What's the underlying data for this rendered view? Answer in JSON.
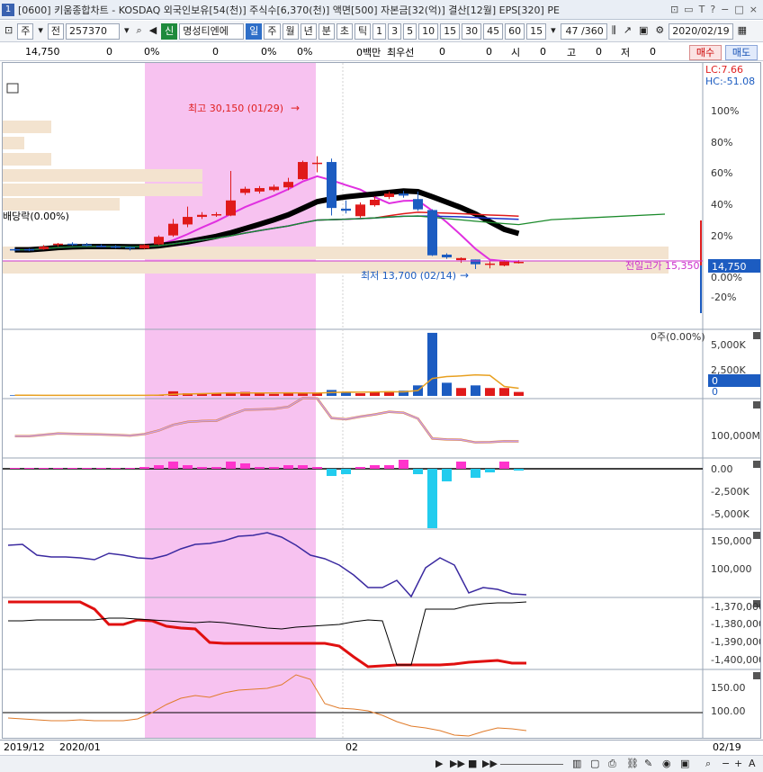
{
  "window": {
    "number": "1",
    "title": "[0600] 키움종합차트 - KOSDAQ 외국인보유[54(천)] 주식수[6,370(천)] 액면[500] 자본금[32(억)] 결산[12월] EPS[320] PE",
    "buttons": [
      "⊡",
      "▭",
      "T",
      "?",
      "−",
      "□",
      "×"
    ]
  },
  "toolbar": {
    "period_select": "주",
    "range_label": "전",
    "stock_code": "257370",
    "search_icon": "search-icon",
    "badge": "신",
    "stock_name": "명성티엔에",
    "periods": [
      "일",
      "주",
      "월",
      "년",
      "분",
      "초",
      "틱"
    ],
    "active_period": "일",
    "intervals": [
      "1",
      "3",
      "5",
      "10",
      "15",
      "30",
      "45",
      "60"
    ],
    "count_select": "15",
    "page": "47 /360",
    "date": "2020/02/19"
  },
  "quote": {
    "price": "14,750",
    "v1": "0",
    "v2": "0%",
    "v3": "0",
    "v4": "0%",
    "v5": "0%",
    "amount": "0백만",
    "best_ask_label": "최우선",
    "v6": "0",
    "v7": "0",
    "open_label": "시",
    "open": "0",
    "high_label": "고",
    "high": "0",
    "low_label": "저",
    "low": "0",
    "buy": "매수",
    "sell": "매도"
  },
  "price_panel": {
    "lc": "LC:7.66",
    "hc": "HC:-51.08",
    "y_labels": [
      "100%",
      "80%",
      "60%",
      "40%",
      "20%",
      "0.00%",
      "-20%"
    ],
    "high_note": "최고 30,150 (01/29)",
    "low_note": "최저 13,700 (02/14)",
    "prev_close_note": "전일고가 15,350",
    "dividend_note": "배당락(0.00%)",
    "current_price": "14,750"
  },
  "volume_panel": {
    "note": "0주(0.00%)",
    "y_labels": [
      "5,000K",
      "2,500K",
      "0"
    ],
    "current": "0"
  },
  "amount_panel": {
    "y_labels": [
      "100,000M"
    ]
  },
  "foreign_panel": {
    "y_labels": [
      "0.00",
      "-2,500K",
      "-5,000K"
    ]
  },
  "indicator1": {
    "y_labels": [
      "150,000",
      "100,000"
    ]
  },
  "indicator2": {
    "y_labels": [
      "-1,370,000",
      "-1,380,000",
      "-1,390,000",
      "-1,400,000"
    ]
  },
  "indicator3": {
    "y_labels": [
      "150.00",
      "100.00"
    ]
  },
  "dates": {
    "d1": "2019/12",
    "d2": "2020/01",
    "d3": "02",
    "d4": "02/19"
  },
  "candles": [
    {
      "o": 16600,
      "c": 16500,
      "h": 16800,
      "l": 16300
    },
    {
      "o": 16600,
      "c": 16500,
      "h": 16700,
      "l": 16300
    },
    {
      "o": 16600,
      "c": 16950,
      "h": 17200,
      "l": 16500
    },
    {
      "o": 17200,
      "c": 17400,
      "h": 17500,
      "l": 17000
    },
    {
      "o": 17400,
      "c": 17300,
      "h": 17600,
      "l": 17100
    },
    {
      "o": 17300,
      "c": 17200,
      "h": 17500,
      "l": 17000
    },
    {
      "o": 17100,
      "c": 17050,
      "h": 17300,
      "l": 16900
    },
    {
      "o": 17000,
      "c": 16900,
      "h": 17200,
      "l": 16700
    },
    {
      "o": 16900,
      "c": 16700,
      "h": 17000,
      "l": 16400
    },
    {
      "o": 16700,
      "c": 17200,
      "h": 17300,
      "l": 16600
    },
    {
      "o": 17300,
      "c": 18400,
      "h": 18600,
      "l": 17200
    },
    {
      "o": 18600,
      "c": 20300,
      "h": 21000,
      "l": 18400
    },
    {
      "o": 20200,
      "c": 21300,
      "h": 22800,
      "l": 19800
    },
    {
      "o": 21300,
      "c": 21600,
      "h": 22000,
      "l": 21000
    },
    {
      "o": 21500,
      "c": 21700,
      "h": 22000,
      "l": 21300
    },
    {
      "o": 21500,
      "c": 23700,
      "h": 28000,
      "l": 21400
    },
    {
      "o": 24800,
      "c": 25400,
      "h": 25700,
      "l": 24500
    },
    {
      "o": 25000,
      "c": 25500,
      "h": 25800,
      "l": 24700
    },
    {
      "o": 25200,
      "c": 25700,
      "h": 26000,
      "l": 25000
    },
    {
      "o": 25600,
      "c": 26400,
      "h": 27000,
      "l": 25200
    },
    {
      "o": 26800,
      "c": 29300,
      "h": 29500,
      "l": 26700
    },
    {
      "o": 29000,
      "c": 29200,
      "h": 30150,
      "l": 27800
    },
    {
      "o": 29300,
      "c": 22600,
      "h": 29800,
      "l": 21500
    },
    {
      "o": 22500,
      "c": 22200,
      "h": 23700,
      "l": 21800
    },
    {
      "o": 21400,
      "c": 23100,
      "h": 23400,
      "l": 21200
    },
    {
      "o": 23000,
      "c": 23800,
      "h": 24300,
      "l": 22800
    },
    {
      "o": 24200,
      "c": 24700,
      "h": 25000,
      "l": 23900
    },
    {
      "o": 24700,
      "c": 24400,
      "h": 25100,
      "l": 24100
    },
    {
      "o": 23900,
      "c": 22400,
      "h": 25000,
      "l": 22200
    },
    {
      "o": 22300,
      "c": 15700,
      "h": 22400,
      "l": 15600
    },
    {
      "o": 15800,
      "c": 15400,
      "h": 16000,
      "l": 15200
    },
    {
      "o": 15000,
      "c": 15300,
      "h": 15400,
      "l": 14600
    },
    {
      "o": 15100,
      "c": 14400,
      "h": 15100,
      "l": 13700
    },
    {
      "o": 14400,
      "c": 14500,
      "h": 14800,
      "l": 13800
    },
    {
      "o": 14200,
      "c": 14800,
      "h": 15000,
      "l": 14100
    },
    {
      "o": 14600,
      "c": 14750,
      "h": 15000,
      "l": 14500
    }
  ],
  "volume": [
    0.05,
    0.05,
    0.04,
    0.04,
    0.05,
    0.04,
    0.05,
    0.05,
    0.04,
    0.05,
    0.1,
    0.35,
    0.2,
    0.15,
    0.2,
    0.25,
    0.3,
    0.2,
    0.15,
    0.25,
    0.2,
    0.25,
    0.45,
    0.3,
    0.2,
    0.3,
    0.35,
    0.4,
    0.8,
    4.8,
    1.0,
    0.6,
    0.8,
    0.6,
    0.6,
    0.3
  ],
  "foreign_net": [
    0.05,
    0.05,
    0.05,
    0.05,
    0.05,
    0.05,
    0.05,
    0.05,
    0.05,
    0.1,
    0.2,
    0.4,
    0.2,
    0.1,
    0.1,
    0.4,
    0.3,
    0.1,
    0.1,
    0.2,
    0.2,
    0.1,
    -0.4,
    -0.3,
    0.1,
    0.2,
    0.2,
    0.5,
    -0.3,
    -3.3,
    -0.7,
    0.4,
    -0.5,
    -0.2,
    0.4,
    -0.1
  ]
}
